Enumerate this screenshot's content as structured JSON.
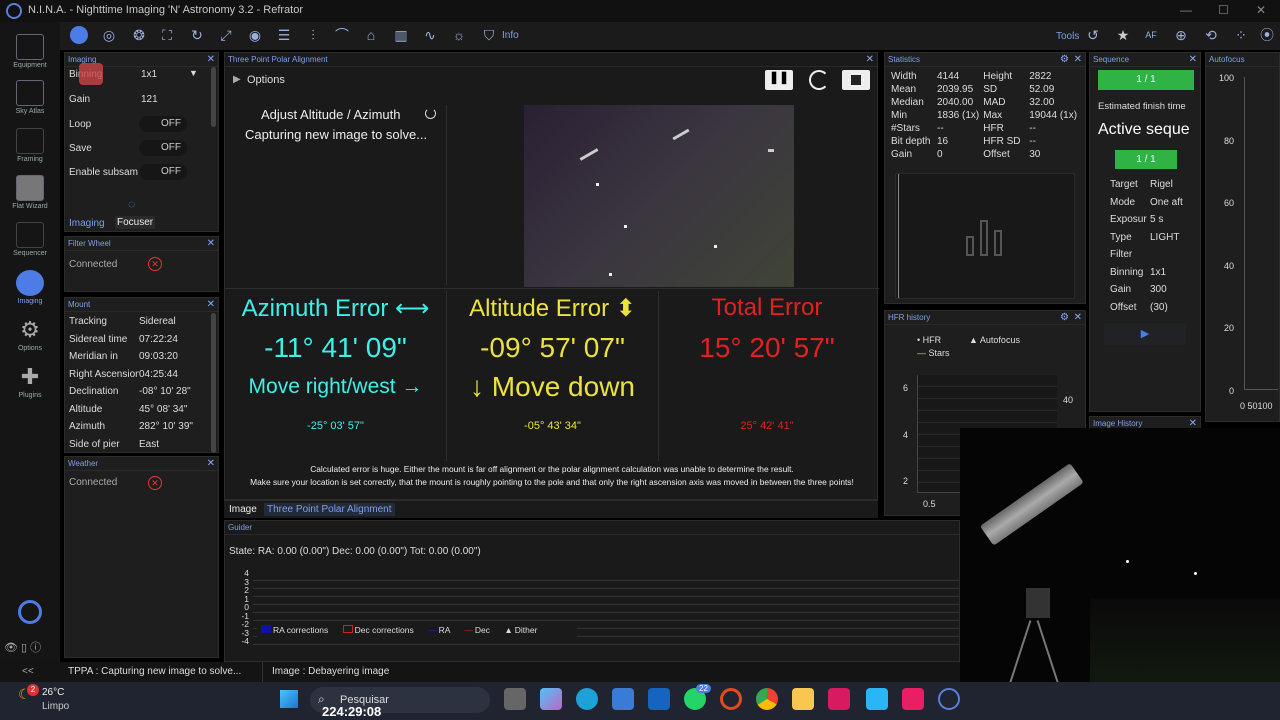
{
  "window": {
    "title": "N.I.N.A. - Nighttime Imaging 'N' Astronomy 3.2   -  Refrator"
  },
  "toolbar": {
    "tools_label": "Tools",
    "info_label": "Info"
  },
  "nav": {
    "items": [
      {
        "label": "Equipment"
      },
      {
        "label": "Sky Atlas"
      },
      {
        "label": "Framing"
      },
      {
        "label": "Flat Wizard"
      },
      {
        "label": "Sequencer"
      },
      {
        "label": "Imaging"
      },
      {
        "label": "Options"
      },
      {
        "label": "Plugins"
      }
    ]
  },
  "imaging": {
    "title": "Imaging",
    "binning_label": "Binning",
    "binning_value": "1x1",
    "gain_label": "Gain",
    "gain_value": "121",
    "loop_label": "Loop",
    "loop_value": "OFF",
    "save_label": "Save",
    "save_value": "OFF",
    "subsam_label": "Enable subsam",
    "subsam_value": "OFF",
    "tab_imaging": "Imaging",
    "tab_focuser": "Focuser"
  },
  "filterwheel": {
    "title": "Filter Wheel",
    "status": "Connected"
  },
  "mount": {
    "title": "Mount",
    "rows": [
      {
        "k": "Tracking",
        "v": "Sidereal"
      },
      {
        "k": "Sidereal time",
        "v": "07:22:24"
      },
      {
        "k": "Meridian in",
        "v": "09:03:20"
      },
      {
        "k": "Right Ascension",
        "v": "04:25:44"
      },
      {
        "k": "Declination",
        "v": "-08° 10' 28\""
      },
      {
        "k": "Altitude",
        "v": "45° 08' 34\""
      },
      {
        "k": "Azimuth",
        "v": "282° 10' 39\""
      },
      {
        "k": "Side of pier",
        "v": "East"
      }
    ]
  },
  "weather": {
    "title": "Weather",
    "status": "Connected"
  },
  "tppa": {
    "title": "Three Point Polar Alignment",
    "options_label": "Options",
    "step_title": "Adjust Altitude / Azimuth",
    "step_status": "Capturing new image to solve...",
    "az_title": "Azimuth Error ⟷",
    "az_value": "-11° 41' 09\"",
    "az_move": "Move right/west →",
    "az_small": "-25° 03' 57\"",
    "alt_title": "Altitude Error ⬍",
    "alt_value": "-09° 57' 07\"",
    "alt_move": "↓ Move down",
    "alt_small": "-05° 43' 34\"",
    "tot_title": "Total Error",
    "tot_value": "15° 20' 57\"",
    "tot_small": "25° 42' 41\"",
    "warn1": "Calculated error is huge. Either the mount is far off alignment or the polar alignment calculation was unable to determine the result.",
    "warn2": "Make sure your location is set correctly, that the mount is roughly pointing to the pole and that only the right ascension axis was moved in between the three points!",
    "tab_image": "Image",
    "tab_tppa": "Three Point Polar Alignment"
  },
  "stats": {
    "title": "Statistics",
    "rows": [
      [
        "Width",
        "4144",
        "Height",
        "2822"
      ],
      [
        "Mean",
        "2039.95",
        "SD",
        "52.09"
      ],
      [
        "Median",
        "2040.00",
        "MAD",
        "32.00"
      ],
      [
        "Min",
        "1836 (1x)",
        "Max",
        "19044 (1x)"
      ],
      [
        "#Stars",
        "--",
        "HFR",
        "--"
      ],
      [
        "Bit depth",
        "16",
        "HFR SD",
        "--"
      ],
      [
        "Gain",
        "0",
        "Offset",
        "30"
      ]
    ]
  },
  "hfr": {
    "title": "HFR history",
    "legend_hfr": "HFR",
    "legend_af": "Autofocus",
    "legend_stars": "Stars",
    "y_ticks": [
      "6",
      "4",
      "2"
    ],
    "y2_tick": "40",
    "x_tick": "0.5"
  },
  "sequence": {
    "title": "Sequence",
    "progress": "1 / 1",
    "finish_label": "Estimated finish time",
    "active": "Active seque",
    "progress2": "1 / 1",
    "rows": [
      {
        "k": "Target",
        "v": "Rigel"
      },
      {
        "k": "Mode",
        "v": "One aft"
      },
      {
        "k": "Exposur",
        "v": "5 s"
      },
      {
        "k": "Type",
        "v": "LIGHT"
      },
      {
        "k": "Filter",
        "v": ""
      },
      {
        "k": "Binning",
        "v": "1x1"
      },
      {
        "k": "Gain",
        "v": "300"
      },
      {
        "k": "Offset",
        "v": "(30)"
      }
    ]
  },
  "imagehistory": {
    "title": "Image History"
  },
  "autofocus": {
    "title": "Autofocus",
    "y_ticks": [
      "100",
      "80",
      "60",
      "40",
      "20",
      "0"
    ],
    "x_ticks": "0 50100"
  },
  "guider": {
    "title": "Guider",
    "state": "State:  RA: 0.00 (0.00\")  Dec: 0.00 (0.00\")  Tot: 0.00 (0.00\")",
    "y_ticks": [
      "4",
      "3",
      "2",
      "1",
      "0",
      "-1",
      "-2",
      "-3",
      "-4"
    ],
    "legend": [
      "RA corrections",
      "Dec corrections",
      "RA",
      "Dec",
      "Dither"
    ]
  },
  "status": {
    "tppa": "TPPA :   Capturing new image to solve...",
    "image": "Image :   Debayering image",
    "nav_collapse": "<<"
  },
  "taskbar": {
    "temp": "26°C",
    "weather": "Limpo",
    "search": "Pesquisar",
    "clock": "224:29:08",
    "badge": "22",
    "notif": "2"
  }
}
